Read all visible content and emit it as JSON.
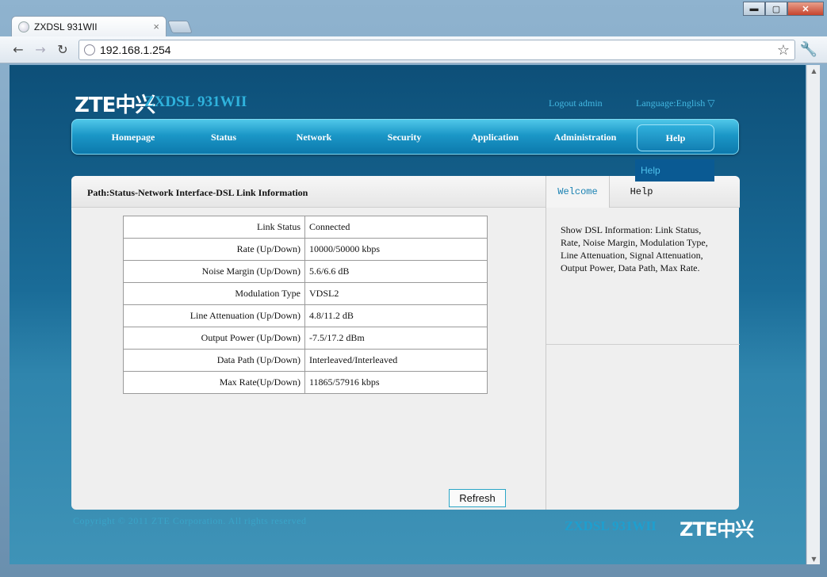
{
  "browser": {
    "tab_title": "ZXDSL 931WII",
    "url": "192.168.1.254",
    "window_buttons": {
      "minimize": "▬",
      "maximize": "▢",
      "close": "✕"
    },
    "icons": {
      "back": "back-arrow-icon",
      "forward": "forward-arrow-icon",
      "reload": "reload-icon",
      "star": "star-icon",
      "wrench": "wrench-icon"
    }
  },
  "header": {
    "logo_text": "ZTE中兴",
    "product": "ZXDSL 931WII",
    "logout": "Logout admin",
    "language": "Language:English ▽"
  },
  "nav": {
    "items": [
      "Homepage",
      "Status",
      "Network",
      "Security",
      "Application",
      "Administration",
      "Help"
    ],
    "active": "Help",
    "dropdown_item": "Help"
  },
  "path": "Path:Status-Network Interface-DSL Link Information",
  "dsl_table": [
    {
      "label": "Link Status",
      "value": "Connected"
    },
    {
      "label": "Rate (Up/Down)",
      "value": "10000/50000 kbps"
    },
    {
      "label": "Noise Margin (Up/Down)",
      "value": "5.6/6.6 dB"
    },
    {
      "label": "Modulation Type",
      "value": "VDSL2"
    },
    {
      "label": "Line Attenuation (Up/Down)",
      "value": "4.8/11.2 dB"
    },
    {
      "label": "Output Power (Up/Down)",
      "value": "-7.5/17.2 dBm"
    },
    {
      "label": "Data Path (Up/Down)",
      "value": "Interleaved/Interleaved"
    },
    {
      "label": "Max Rate(Up/Down)",
      "value": "11865/57916 kbps"
    }
  ],
  "refresh_label": "Refresh",
  "help_panel": {
    "tab_welcome": "Welcome",
    "tab_help": "Help",
    "text": "Show DSL Information: Link Status, Rate, Noise Margin, Modulation Type, Line Attenuation, Signal Attenuation, Output Power, Data Path, Max Rate."
  },
  "footer": {
    "copyright": "Copyright © 2011 ZTE Corporation. All rights reserved",
    "product": "ZXDSL 931WII",
    "logo_text": "ZTE中兴"
  },
  "colors": {
    "accent": "#2fb3dd",
    "nav_gradient_top": "#4fc7e9",
    "nav_gradient_bottom": "#0c79ac",
    "panel_bg": "#efefef"
  }
}
